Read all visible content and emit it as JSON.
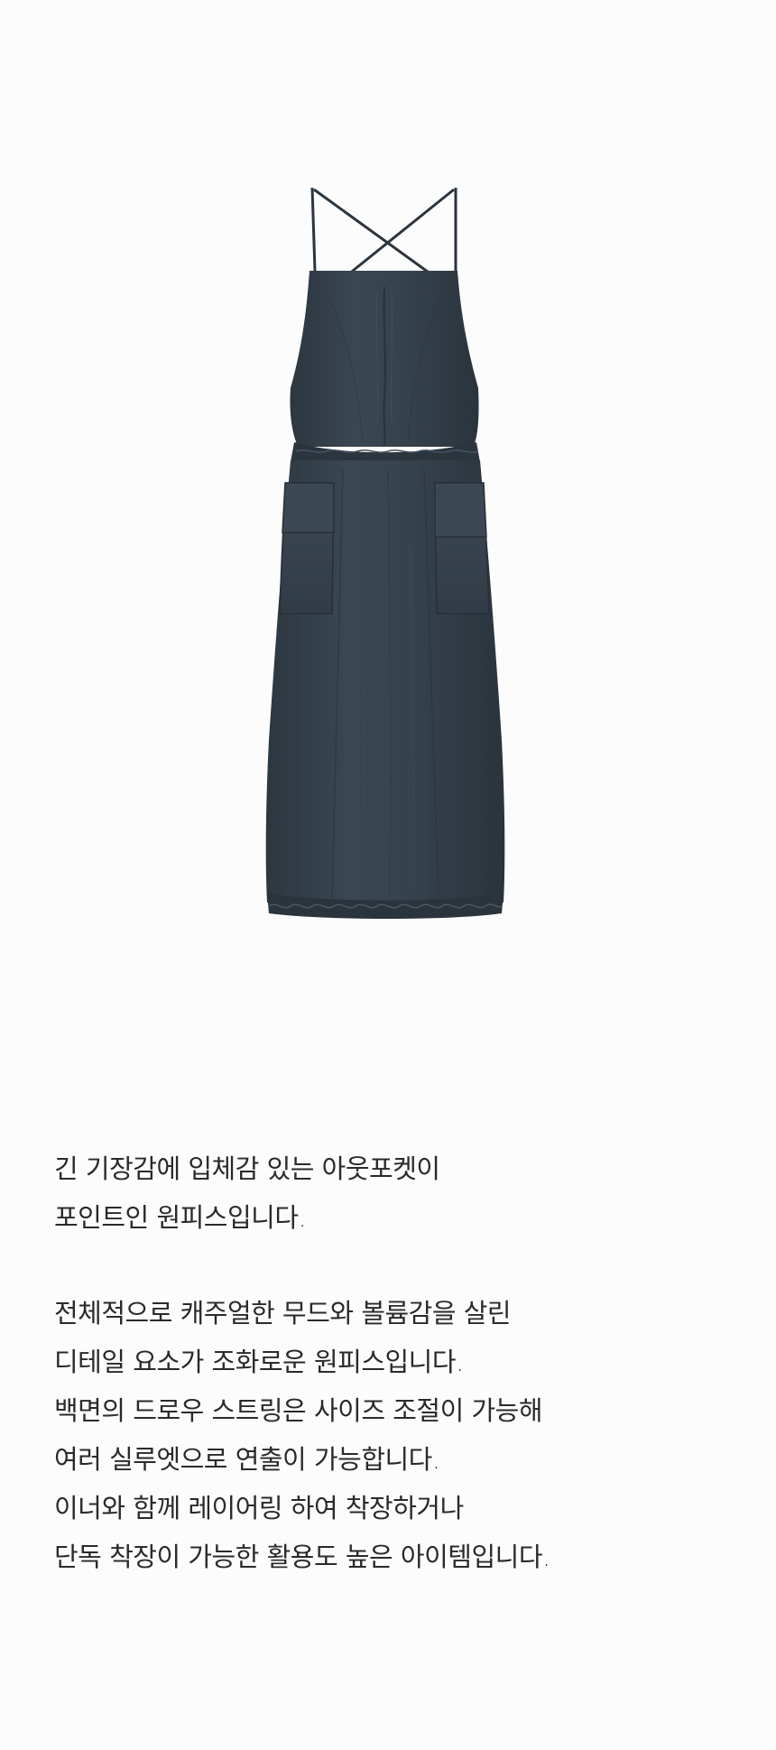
{
  "product_image": {
    "subject": "dress-icon",
    "dress_color": "#34404a",
    "background": "#fdfcfd"
  },
  "description": {
    "paragraphs": [
      {
        "lines": [
          "긴 기장감에 입체감 있는 아웃포켓이",
          "포인트인 원피스입니다."
        ]
      },
      {
        "lines": [
          "전체적으로 캐주얼한 무드와 볼륨감을 살린",
          "디테일 요소가 조화로운 원피스입니다.",
          "백면의 드로우 스트링은 사이즈 조절이 가능해",
          "여러 실루엣으로 연출이 가능합니다.",
          "이너와 함께 레이어링 하여 착장하거나",
          "단독 착장이 가능한 활용도 높은 아이템입니다."
        ]
      }
    ]
  }
}
